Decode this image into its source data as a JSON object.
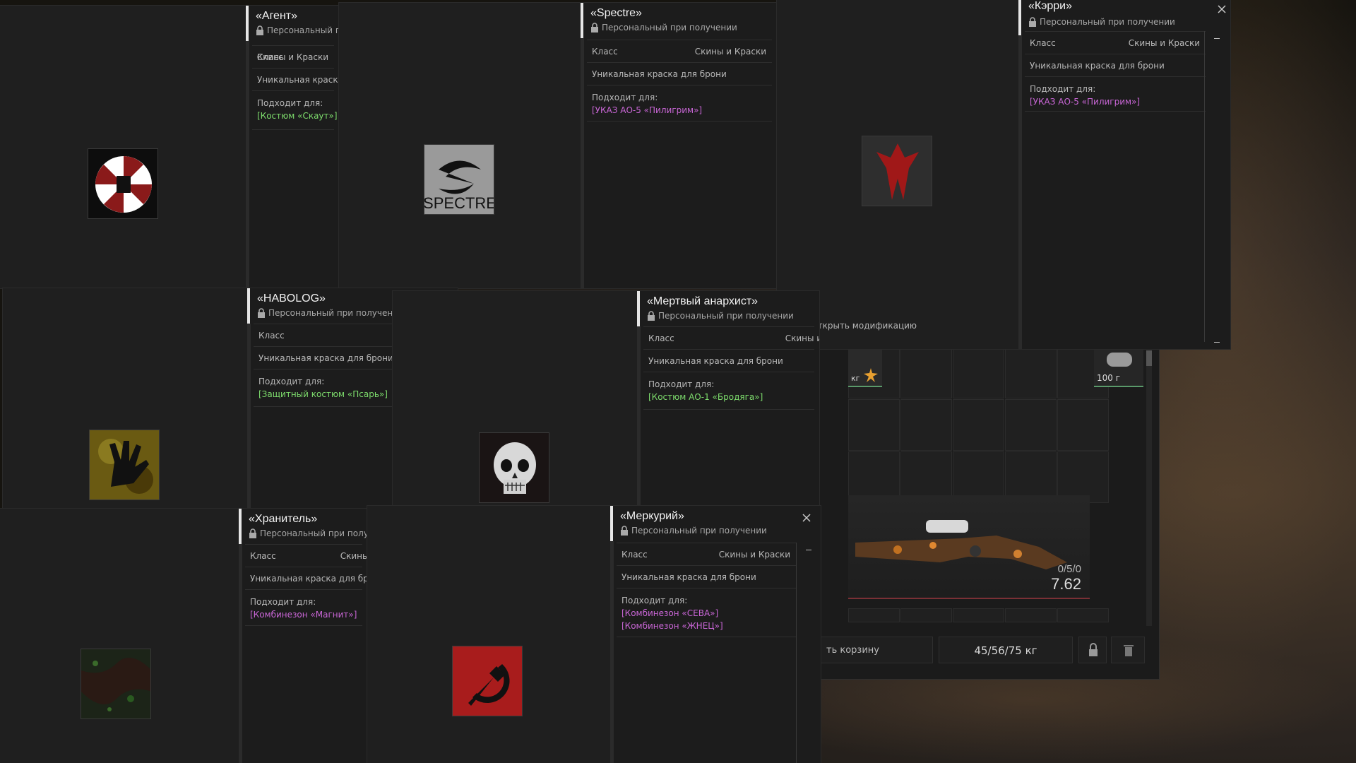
{
  "common": {
    "class_label": "Класс",
    "class_value": "Скины и Краски",
    "desc": "Уникальная краска для брони",
    "fits_label": "Подходит для:",
    "personal": "Персональный при получении"
  },
  "cards": [
    {
      "title": "«Агент»",
      "fits": [
        "[Костюм «Скаут»]"
      ],
      "fits_color": "#7ddc6c",
      "icon": "umbrella-emblem-icon"
    },
    {
      "title": "«Spectre»",
      "fits": [
        "[УКАЗ АО-5 «Пилигрим»]"
      ],
      "fits_color": "#c966d6",
      "icon": "spectre-logo-icon"
    },
    {
      "title": "«Кэрри»",
      "fits": [
        "[УКАЗ АО-5 «Пилигрим»]"
      ],
      "fits_color": "#c966d6",
      "icon": "red-demon-icon"
    },
    {
      "title": "«HABOLOG»",
      "fits": [
        "[Защитный костюм «Псарь»]"
      ],
      "fits_color": "#7ddc6c",
      "icon": "handprint-icon"
    },
    {
      "title": "«Мертвый анархист»",
      "fits": [
        "[Костюм АО-1 «Бродяга»]"
      ],
      "fits_color": "#7ddc6c",
      "icon": "skull-icon"
    },
    {
      "title": "«Хранитель»",
      "fits": [
        "[Комбинезон «Магнит»]"
      ],
      "fits_color": "#c966d6",
      "icon": "moss-camo-icon"
    },
    {
      "title": "«Меркурий»",
      "fits": [
        "[Комбинезон «СЕВА»]",
        "[Комбинезон «ЖНЕЦ»]"
      ],
      "fits_color": "#c966d6",
      "icon": "hammer-sickle-icon"
    }
  ],
  "hint": {
    "text": "- Открыть модификацию",
    "icon": "mouse-icon"
  },
  "inventory": {
    "basket_label": "ть корзину",
    "weight": "45/56/75 кг",
    "kg_label": "кг",
    "gram_label": "100 г",
    "rifle_ammo": "0/5/0",
    "rifle_caliber": "7.62",
    "lock_icon": "lock-icon",
    "trash_icon": "trash-icon"
  }
}
